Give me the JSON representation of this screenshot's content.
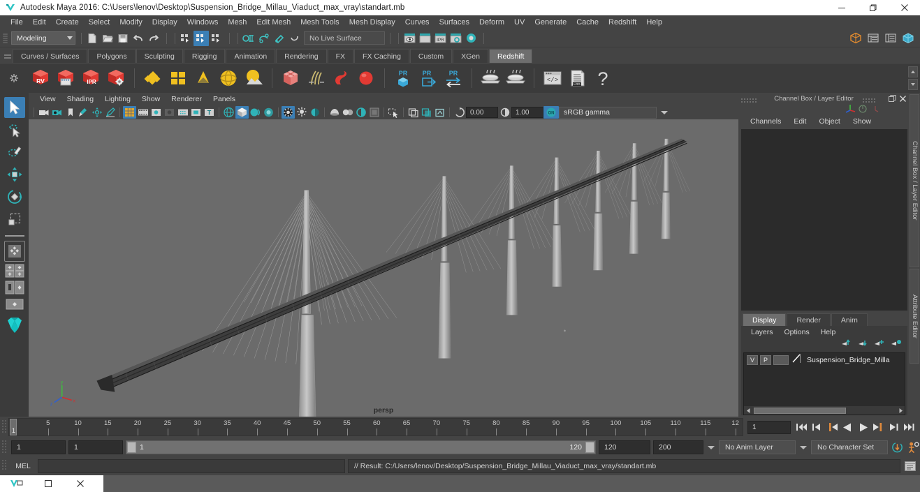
{
  "titlebar": {
    "app_icon": "maya-icon",
    "title": "Autodesk Maya 2016: C:\\Users\\lenov\\Desktop\\Suspension_Bridge_Millau_Viaduct_max_vray\\standart.mb",
    "minimize": "minimize-icon",
    "maximize": "restore-icon",
    "close": "close-icon"
  },
  "menubar": {
    "items": [
      "File",
      "Edit",
      "Create",
      "Select",
      "Modify",
      "Display",
      "Windows",
      "Mesh",
      "Edit Mesh",
      "Mesh Tools",
      "Mesh Display",
      "Curves",
      "Surfaces",
      "Deform",
      "UV",
      "Generate",
      "Cache",
      "Redshift",
      "Help"
    ]
  },
  "statusline": {
    "mode": "Modeling",
    "live_surface": "No Live Surface",
    "icons": [
      "new-scene-icon",
      "open-scene-icon",
      "save-scene-icon",
      "undo-icon",
      "redo-icon",
      "select-by-hierarchy-icon",
      "select-by-object-icon",
      "select-by-component-icon",
      "snap-to-grid-icon",
      "snap-to-curve-icon",
      "snap-to-point-icon",
      "snap-to-view-plane-icon",
      "render-view-icon",
      "render-frame-icon",
      "ipr-render-icon",
      "render-settings-icon",
      "hypershade-icon"
    ]
  },
  "shelf": {
    "tabs": [
      "Curves / Surfaces",
      "Polygons",
      "Sculpting",
      "Rigging",
      "Animation",
      "Rendering",
      "FX",
      "FX Caching",
      "Custom",
      "XGen",
      "Redshift"
    ],
    "active_tab": "Redshift",
    "icons": [
      {
        "name": "redshift-render-view",
        "label": "RV"
      },
      {
        "name": "redshift-render-sequence",
        "label": ""
      },
      {
        "name": "redshift-ipr",
        "label": "IPR"
      },
      {
        "name": "redshift-render-settings",
        "label": ""
      },
      {
        "name": "redshift-material",
        "label": ""
      },
      {
        "name": "redshift-material-blender",
        "label": ""
      },
      {
        "name": "redshift-light-area",
        "label": ""
      },
      {
        "name": "redshift-light-dome",
        "label": ""
      },
      {
        "name": "redshift-light-physical-sun",
        "label": ""
      },
      {
        "name": "redshift-proxy",
        "label": ""
      },
      {
        "name": "redshift-hair",
        "label": ""
      },
      {
        "name": "redshift-volume",
        "label": ""
      },
      {
        "name": "redshift-sphere-primitive",
        "label": ""
      },
      {
        "name": "redshift-proxy-object",
        "label": "PR"
      },
      {
        "name": "redshift-proxy-export",
        "label": "PR"
      },
      {
        "name": "redshift-proxy-swap",
        "label": "PR"
      },
      {
        "name": "redshift-bake-set",
        "label": ""
      },
      {
        "name": "redshift-bake-render",
        "label": ""
      },
      {
        "name": "redshift-script-editor",
        "label": ""
      },
      {
        "name": "redshift-log",
        "label": "LOG"
      },
      {
        "name": "redshift-help",
        "label": "?"
      }
    ]
  },
  "toolbox": {
    "tools": [
      "select-tool",
      "lasso-select-tool",
      "paint-select-tool",
      "move-tool",
      "rotate-tool",
      "scale-tool",
      "last-tool",
      "four-view-layout",
      "persp-outliner-layout",
      "persp-graph-layout",
      "single-persp-layout",
      "hypershade-layout"
    ]
  },
  "viewport": {
    "menus": [
      "View",
      "Shading",
      "Lighting",
      "Show",
      "Renderer",
      "Panels"
    ],
    "camera_label": "persp",
    "exposure": "0.00",
    "gamma": "1.00",
    "color_profile": "sRGB gamma",
    "toolbar_icons": [
      "select-camera-icon",
      "lock-camera-icon",
      "bookmark-icon",
      "image-plane-icon",
      "2d-pan-zoom-icon",
      "grease-pencil-icon",
      "grid-icon",
      "film-gate-icon",
      "resolution-gate-icon",
      "gate-mask-icon",
      "film-origin-icon",
      "safe-action-icon",
      "text-overlay-icon",
      "wireframe-icon",
      "smooth-shade-icon",
      "flat-shade-icon",
      "shaded-wireframe-icon",
      "textured-icon",
      "lights-icon",
      "shadows-icon",
      "ambient-occlusion-icon",
      "motion-blur-icon",
      "multisample-icon",
      "depth-of-field-icon",
      "isolate-select-icon",
      "xray-icon",
      "xray-joints-icon",
      "xray-active-icon",
      "exposure-icon",
      "gamma-icon",
      "color-management-icon"
    ],
    "scene_description": "Millau Viaduct suspension bridge wireframe model"
  },
  "channelbox": {
    "panel_title": "Channel Box / Layer Editor",
    "menus": [
      "Channels",
      "Edit",
      "Object",
      "Show"
    ],
    "undock_icon": "undock-icon",
    "close_icon": "close-icon"
  },
  "layer_editor": {
    "tabs": [
      "Display",
      "Render",
      "Anim"
    ],
    "active_tab": "Display",
    "menus": [
      "Layers",
      "Options",
      "Help"
    ],
    "toolbar_icons": [
      "move-layer-up-icon",
      "move-layer-down-icon",
      "new-layer-icon",
      "new-layer-from-selected-icon"
    ],
    "layers": [
      {
        "visibility": "V",
        "playback": "P",
        "type": "",
        "color_swatch": "#ffffff",
        "name": "Suspension_Bridge_Milla"
      }
    ]
  },
  "right_vtabs": [
    "Channel Box / Layer Editor",
    "Attribute Editor"
  ],
  "timeslider": {
    "tick_labels": [
      "5",
      "10",
      "15",
      "20",
      "25",
      "30",
      "35",
      "40",
      "45",
      "50",
      "55",
      "60",
      "65",
      "70",
      "75",
      "80",
      "85",
      "90",
      "95",
      "100",
      "105",
      "110",
      "115",
      "12"
    ],
    "current_frame_marker": "1",
    "current_frame_field": "1",
    "playback_buttons": [
      "go-to-start-icon",
      "step-back-keyframe-icon",
      "step-back-frame-icon",
      "play-backwards-icon",
      "play-forwards-icon",
      "step-forward-frame-icon",
      "step-forward-keyframe-icon",
      "go-to-end-icon"
    ]
  },
  "rangeslider": {
    "start_field": "1",
    "range_start_field": "1",
    "range_bar_start": "1",
    "range_bar_end": "120",
    "range_end_field": "120",
    "end_field": "200",
    "anim_layer": "No Anim Layer",
    "character_set": "No Character Set",
    "auto_key_icon": "auto-keyframe-icon",
    "anim_prefs_icon": "animation-preferences-icon"
  },
  "commandline": {
    "language_label": "MEL",
    "input_value": "",
    "result_text": "// Result: C:/Users/lenov/Desktop/Suspension_Bridge_Millau_Viaduct_max_vray/standart.mb",
    "script_editor_icon": "script-editor-icon"
  },
  "taskbar": {
    "items": [
      "maya-taskbar-icon",
      "restore-taskbar-icon",
      "close-taskbar-icon"
    ]
  },
  "colors": {
    "accent_blue": "#3b7fb5",
    "panel_bg": "#444444",
    "viewport_bg": "#6b6b6b",
    "field_bg": "#2e2e2e",
    "redshift_red": "#e23a33",
    "teal": "#2fb3b8"
  }
}
